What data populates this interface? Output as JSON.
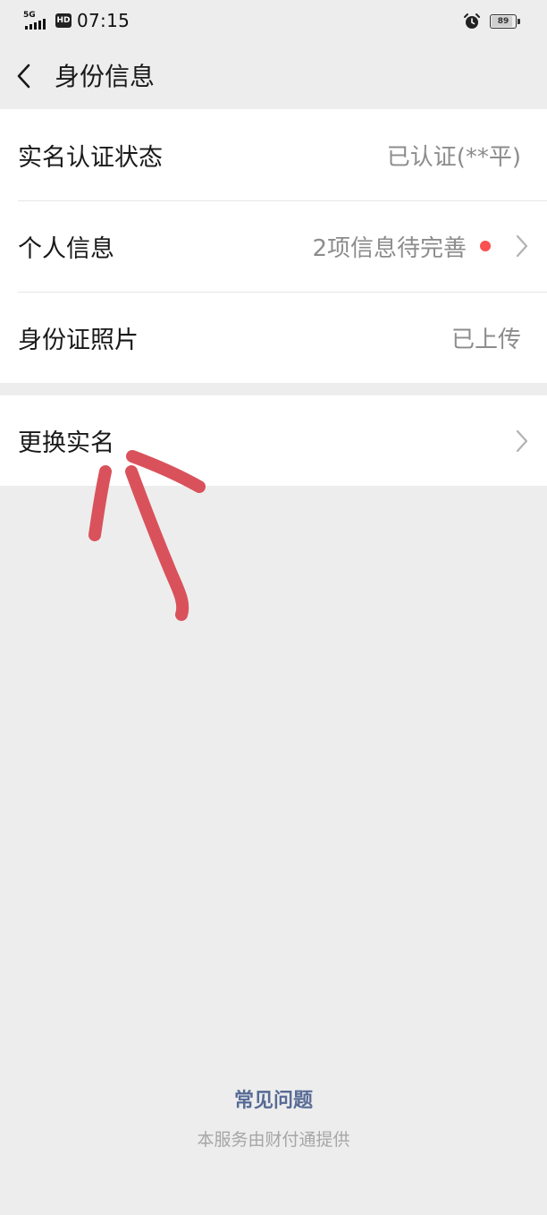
{
  "status_bar": {
    "network": "5G",
    "hd": "HD",
    "time": "07:15",
    "battery_level": "89",
    "battery_fraction": 0.89
  },
  "header": {
    "title": "身份信息",
    "back_icon": "chevron-left-icon"
  },
  "identity_items": [
    {
      "label": "实名认证状态",
      "value": "已认证(**平)"
    },
    {
      "label": "个人信息",
      "value": "2项信息待完善",
      "badge": "red-dot",
      "chevron": true
    },
    {
      "label": "身份证照片",
      "value": "已上传"
    }
  ],
  "change_name": {
    "label": "更换实名",
    "chevron": true
  },
  "footer": {
    "faq": "常见问题",
    "provider": "本服务由财付通提供"
  },
  "colors": {
    "background": "#ededed",
    "card": "#ffffff",
    "link": "#576b95",
    "badge": "#fa5151",
    "annotation": "#d9525b"
  }
}
